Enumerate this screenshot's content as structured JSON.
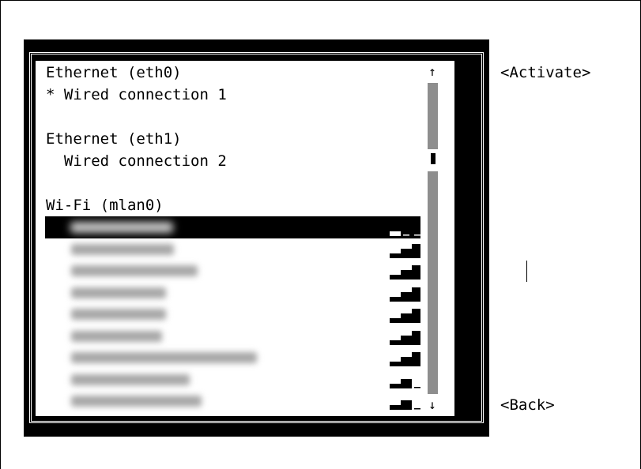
{
  "connections": {
    "ethernet_eth0": {
      "header": "Ethernet (eth0)",
      "item": "* Wired connection 1"
    },
    "ethernet_eth1": {
      "header": "Ethernet (eth1)",
      "item": "  Wired connection 2"
    },
    "wifi": {
      "header": "Wi-Fi (mlan0)"
    }
  },
  "wifi_networks": [
    {
      "selected": true,
      "signal_bars": 1
    },
    {
      "selected": false,
      "signal_bars": 4
    },
    {
      "selected": false,
      "signal_bars": 3
    },
    {
      "selected": false,
      "signal_bars": 3
    },
    {
      "selected": false,
      "signal_bars": 3
    },
    {
      "selected": false,
      "signal_bars": 3
    },
    {
      "selected": false,
      "signal_bars": 3
    },
    {
      "selected": false,
      "signal_bars": 2
    },
    {
      "selected": false,
      "signal_bars": 2
    }
  ],
  "scrollbar": {
    "up_arrow": "↑",
    "down_arrow": "↓"
  },
  "buttons": {
    "activate": "<Activate>",
    "back": "<Back>"
  },
  "colors": {
    "background": "#ffffff",
    "frame": "#000000",
    "scroll_track": "#8e8e8e"
  }
}
